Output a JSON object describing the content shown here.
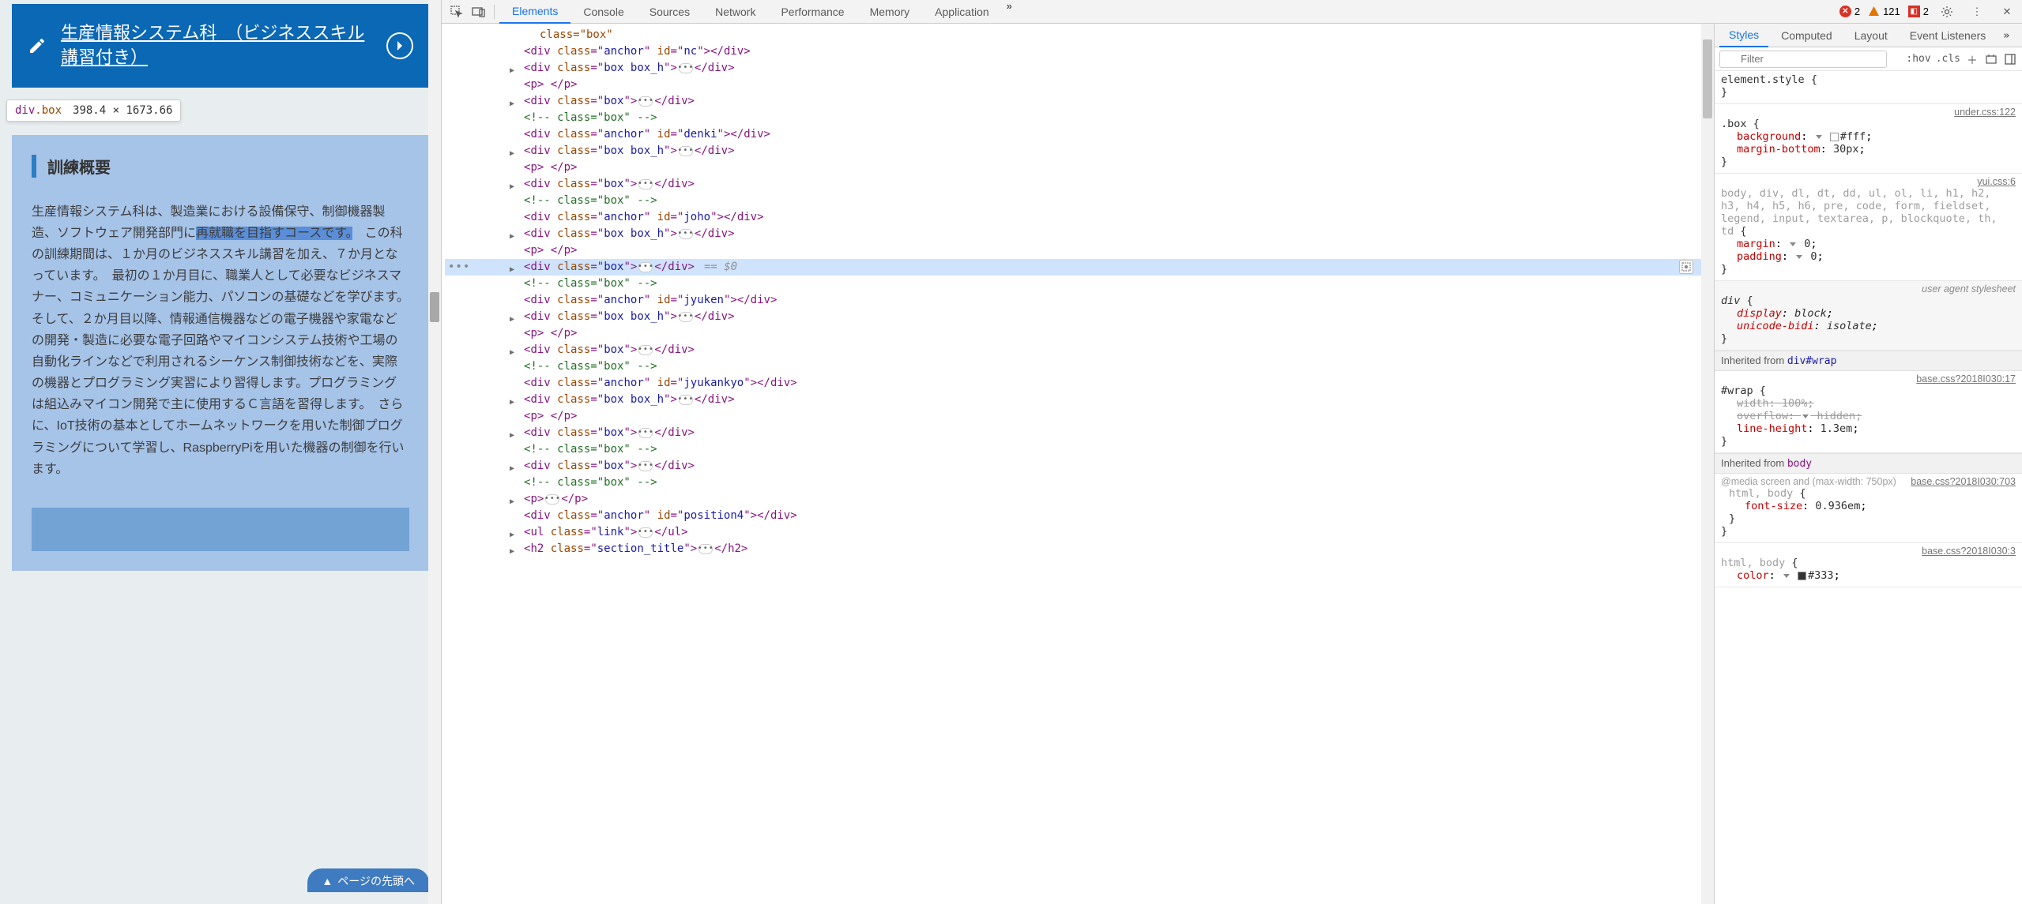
{
  "page": {
    "card_link": "生産情報システム科　（ビジネススキル講習付き）",
    "tooltip_tag": "div",
    "tooltip_cls": ".box",
    "tooltip_dims": "398.4 × 1673.66",
    "box_heading": "訓練概要",
    "box_body_pre": "生産情報システム科は、製造業における設備保守、制御機器製造、ソフトウェア開発部門に",
    "box_body_hl": "再就職を目指すコースです。",
    "box_body_post": "　この科の訓練期間は、１か月のビジネススキル講習を加え、７か月となっています。　最初の１か月目に、職業人として必要なビジネスマナー、コミュニケーション能力、パソコンの基礎などを学びます。　そして、２か月目以降、情報通信機器などの電子機器や家電などの開発・製造に必要な電子回路やマイコンシステム技術や工場の自動化ラインなどで利用されるシーケンス制御技術などを、実際の機器とプログラミング実習により習得します。プログラミングは組込みマイコン開発で主に使用するＣ言語を習得します。　さらに、IoT技術の基本としてホームネットワークを用いた制御プログラミングについて学習し、RaspberryPiを用いた機器の制御を行います。",
    "scroll_top_label": "ページの先頭へ"
  },
  "toolbar": {
    "tabs": [
      "Elements",
      "Console",
      "Sources",
      "Network",
      "Performance",
      "Memory",
      "Application"
    ],
    "active_tab": 0,
    "errors": "2",
    "warnings": "121",
    "hidden": "2"
  },
  "elements": {
    "lines": [
      {
        "ind": 0,
        "sel": false,
        "tog": false,
        "html": "        class=\"box\""
      },
      {
        "ind": 1,
        "sel": false,
        "tog": false,
        "tag": "div",
        "attrs": [
          [
            "class",
            "anchor"
          ],
          [
            "id",
            "nc"
          ]
        ],
        "close": true
      },
      {
        "ind": 1,
        "sel": false,
        "tog": true,
        "tag": "div",
        "attrs": [
          [
            "class",
            "box box_h"
          ]
        ],
        "dots": true,
        "close": true
      },
      {
        "ind": 1,
        "sel": false,
        "tog": false,
        "tag": "p",
        "text": " ",
        "close": true
      },
      {
        "ind": 1,
        "sel": false,
        "tog": true,
        "tag": "div",
        "attrs": [
          [
            "class",
            "box"
          ]
        ],
        "dots": true,
        "close": true
      },
      {
        "ind": 1,
        "sel": false,
        "tog": false,
        "comment": " class=\"box\" "
      },
      {
        "ind": 1,
        "sel": false,
        "tog": false,
        "tag": "div",
        "attrs": [
          [
            "class",
            "anchor"
          ],
          [
            "id",
            "denki"
          ]
        ],
        "close": true
      },
      {
        "ind": 1,
        "sel": false,
        "tog": true,
        "tag": "div",
        "attrs": [
          [
            "class",
            "box box_h"
          ]
        ],
        "dots": true,
        "close": true
      },
      {
        "ind": 1,
        "sel": false,
        "tog": false,
        "tag": "p",
        "text": " ",
        "close": true
      },
      {
        "ind": 1,
        "sel": false,
        "tog": true,
        "tag": "div",
        "attrs": [
          [
            "class",
            "box"
          ]
        ],
        "dots": true,
        "close": true
      },
      {
        "ind": 1,
        "sel": false,
        "tog": false,
        "comment": " class=\"box\" "
      },
      {
        "ind": 1,
        "sel": false,
        "tog": false,
        "tag": "div",
        "attrs": [
          [
            "class",
            "anchor"
          ],
          [
            "id",
            "joho"
          ]
        ],
        "close": true
      },
      {
        "ind": 1,
        "sel": false,
        "tog": true,
        "tag": "div",
        "attrs": [
          [
            "class",
            "box box_h"
          ]
        ],
        "dots": true,
        "close": true
      },
      {
        "ind": 1,
        "sel": false,
        "tog": false,
        "tag": "p",
        "text": " ",
        "close": true
      },
      {
        "ind": 1,
        "sel": true,
        "tog": true,
        "tag": "div",
        "attrs": [
          [
            "class",
            "box"
          ]
        ],
        "dots": true,
        "close": true,
        "eq0": true,
        "gutter": true,
        "reveal": true
      },
      {
        "ind": 1,
        "sel": false,
        "tog": false,
        "comment": " class=\"box\" "
      },
      {
        "ind": 1,
        "sel": false,
        "tog": false,
        "tag": "div",
        "attrs": [
          [
            "class",
            "anchor"
          ],
          [
            "id",
            "jyuken"
          ]
        ],
        "close": true
      },
      {
        "ind": 1,
        "sel": false,
        "tog": true,
        "tag": "div",
        "attrs": [
          [
            "class",
            "box box_h"
          ]
        ],
        "dots": true,
        "close": true
      },
      {
        "ind": 1,
        "sel": false,
        "tog": false,
        "tag": "p",
        "text": " ",
        "close": true
      },
      {
        "ind": 1,
        "sel": false,
        "tog": true,
        "tag": "div",
        "attrs": [
          [
            "class",
            "box"
          ]
        ],
        "dots": true,
        "close": true
      },
      {
        "ind": 1,
        "sel": false,
        "tog": false,
        "comment": " class=\"box\" "
      },
      {
        "ind": 1,
        "sel": false,
        "tog": false,
        "tag": "div",
        "attrs": [
          [
            "class",
            "anchor"
          ],
          [
            "id",
            "jyukankyo"
          ]
        ],
        "close": true
      },
      {
        "ind": 1,
        "sel": false,
        "tog": true,
        "tag": "div",
        "attrs": [
          [
            "class",
            "box box_h"
          ]
        ],
        "dots": true,
        "close": true
      },
      {
        "ind": 1,
        "sel": false,
        "tog": false,
        "tag": "p",
        "text": " ",
        "close": true
      },
      {
        "ind": 1,
        "sel": false,
        "tog": true,
        "tag": "div",
        "attrs": [
          [
            "class",
            "box"
          ]
        ],
        "dots": true,
        "close": true
      },
      {
        "ind": 1,
        "sel": false,
        "tog": false,
        "comment": " class=\"box\" "
      },
      {
        "ind": 1,
        "sel": false,
        "tog": true,
        "tag": "div",
        "attrs": [
          [
            "class",
            "box"
          ]
        ],
        "dots": true,
        "close": true
      },
      {
        "ind": 1,
        "sel": false,
        "tog": false,
        "comment": " class=\"box\" "
      },
      {
        "ind": 1,
        "sel": false,
        "tog": true,
        "tag": "p",
        "dots": true,
        "close": true
      },
      {
        "ind": 1,
        "sel": false,
        "tog": false,
        "tag": "div",
        "attrs": [
          [
            "class",
            "anchor"
          ],
          [
            "id",
            "position4"
          ]
        ],
        "close": true
      },
      {
        "ind": 1,
        "sel": false,
        "tog": true,
        "tag": "ul",
        "attrs": [
          [
            "class",
            "link"
          ]
        ],
        "dots": true,
        "close": true
      },
      {
        "ind": 1,
        "sel": false,
        "tog": true,
        "tag": "h2",
        "attrs": [
          [
            "class",
            "section_title"
          ]
        ],
        "dots": true,
        "close": true
      }
    ]
  },
  "styles": {
    "tabs": [
      "Styles",
      "Computed",
      "Layout",
      "Event Listeners"
    ],
    "active": 0,
    "filter_placeholder": "Filter",
    "hov": ":hov",
    "cls": ".cls",
    "element_style_label": "element.style",
    "sections": [
      {
        "selector": ".box",
        "source": "under.css:122",
        "props": [
          {
            "n": "background",
            "v": "#fff",
            "swatch": "white",
            "tri": true
          },
          {
            "n": "margin-bottom",
            "v": "30px"
          }
        ]
      },
      {
        "selector_list": "body, div, dl, dt, dd, ul, ol, li, h1, h2, h3, h4, h5, h6, pre, code, form, fieldset, legend, input, textarea, p, blockquote, th, td",
        "source": "yui.css:6",
        "props": [
          {
            "n": "margin",
            "v": "0",
            "tri": true
          },
          {
            "n": "padding",
            "v": "0",
            "tri": true
          }
        ]
      },
      {
        "selector_i": "div",
        "ua": "user agent stylesheet",
        "props": [
          {
            "n": "display",
            "v": "block",
            "italic": true
          },
          {
            "n": "unicode-bidi",
            "v": "isolate",
            "italic": true
          }
        ]
      }
    ],
    "inherited_wrap": {
      "label": "Inherited from ",
      "sel": "div#wrap",
      "section": {
        "selector": "#wrap",
        "source": "base.css?2018I030:17",
        "props": [
          {
            "n": "width",
            "v": "100%",
            "strike": true,
            "gray": true
          },
          {
            "n": "overflow",
            "v": "hidden",
            "tri": true,
            "strike": true,
            "gray": true
          },
          {
            "n": "line-height",
            "v": "1.3em"
          }
        ]
      }
    },
    "inherited_body": {
      "label": "Inherited from ",
      "sel": "body",
      "media": "@media screen and (max-width: 750px)",
      "section": {
        "selector": "html, body",
        "source": "base.css?2018I030:703",
        "props": [
          {
            "n": "font-size",
            "v": "0.936em"
          }
        ]
      },
      "section2": {
        "selector": "html, body",
        "source": "base.css?2018I030:3",
        "props": [
          {
            "n": "color",
            "v": "#333",
            "swatch": "dark",
            "tri": true,
            "partial": true
          }
        ]
      }
    }
  }
}
